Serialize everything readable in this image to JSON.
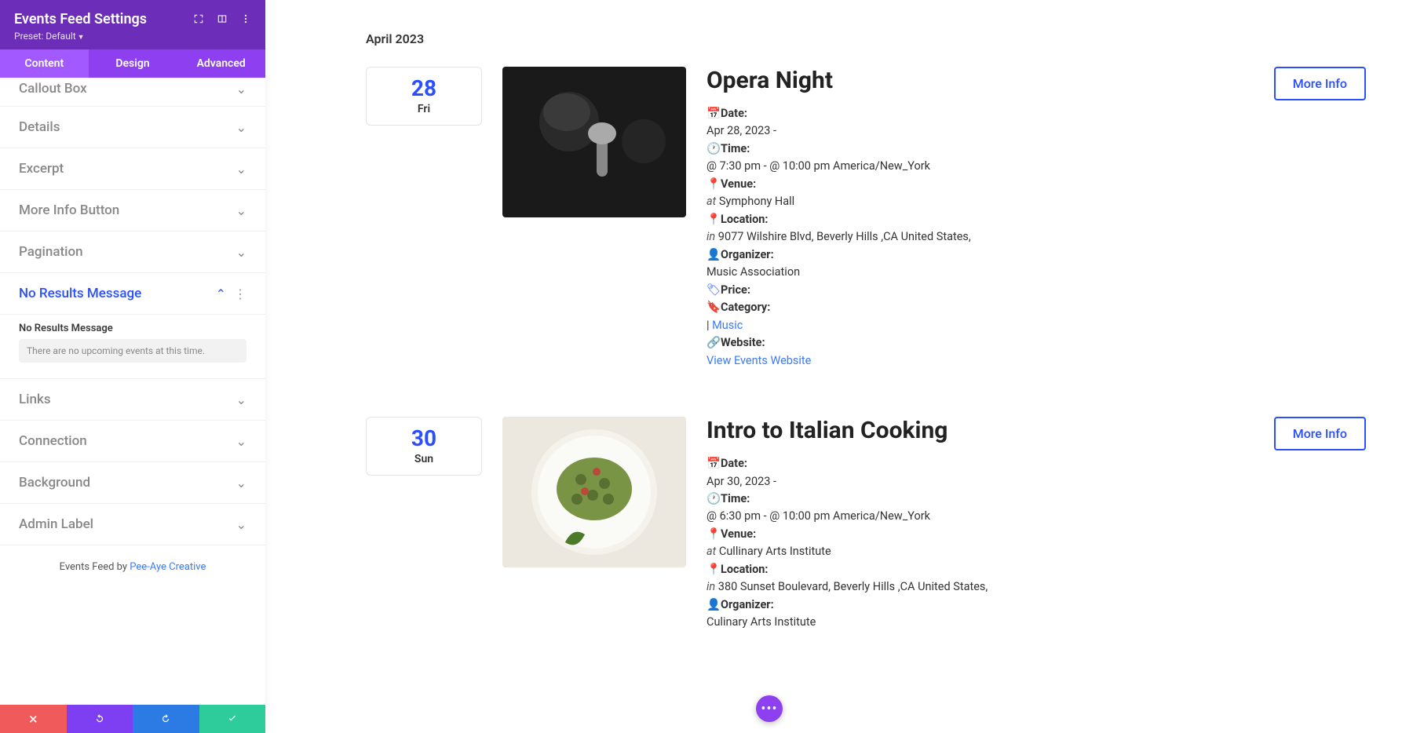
{
  "sidebar": {
    "title": "Events Feed Settings",
    "preset_prefix": "Preset: ",
    "preset_value": "Default",
    "tabs": {
      "content": "Content",
      "design": "Design",
      "advanced": "Advanced"
    },
    "sections": {
      "callout_box": "Callout Box",
      "details": "Details",
      "excerpt": "Excerpt",
      "more_info_button": "More Info Button",
      "pagination": "Pagination",
      "no_results": "No Results Message",
      "links": "Links",
      "connection": "Connection",
      "background": "Background",
      "admin_label": "Admin Label"
    },
    "no_results_field_label": "No Results Message",
    "no_results_value": "There are no upcoming events at this time.",
    "footer_prefix": "Events Feed by ",
    "footer_link": "Pee-Aye Creative"
  },
  "month": "April 2023",
  "events": [
    {
      "date_num": "28",
      "day": "Fri",
      "title": "Opera Night",
      "date_value": "Apr 28, 2023 -",
      "time_value": "@ 7:30 pm - @ 10:00 pm America/New_York",
      "venue_value": "Symphony Hall",
      "location_value": "9077 Wilshire Blvd, Beverly Hills ,CA United States,",
      "organizer_value": "Music Association",
      "price_value": "",
      "category_value": "Music",
      "website_value": "View Events Website",
      "more_info": "More Info"
    },
    {
      "date_num": "30",
      "day": "Sun",
      "title": "Intro to Italian Cooking",
      "date_value": "Apr 30, 2023 -",
      "time_value": "@ 6:30 pm - @ 10:00 pm America/New_York",
      "venue_value": "Cullinary Arts Institute",
      "location_value": "380 Sunset Boulevard, Beverly Hills ,CA United States,",
      "organizer_value": "Culinary Arts Institute",
      "more_info": "More Info"
    }
  ],
  "labels": {
    "date": "Date:",
    "time": "Time:",
    "venue": "Venue:",
    "location": "Location:",
    "organizer": "Organizer:",
    "price": "Price:",
    "category": "Category:",
    "website": "Website:",
    "at": "at",
    "in": "in"
  }
}
